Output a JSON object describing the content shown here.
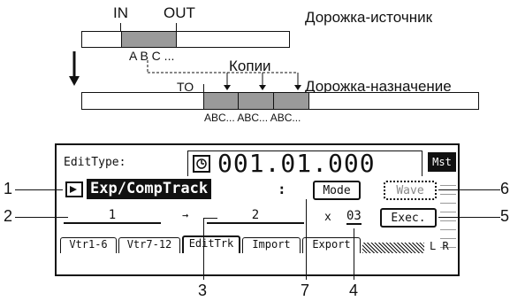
{
  "diagram": {
    "in_label": "IN",
    "out_label": "OUT",
    "source_track_label": "Дорожка-источник",
    "abc_label": "A B C ...",
    "copies_label": "Копии",
    "to_label": "TO",
    "dest_track_label": "Дорожка-назначение",
    "copies_abc": "ABC... ABC... ABC..."
  },
  "screen": {
    "edit_type_label": "EditType:",
    "time_value": "001.01.000",
    "mst_label": "Mst",
    "function_name": "Exp/CompTrack",
    "colon": ":",
    "mode_button": "Mode",
    "wave_button": "Wave",
    "exec_button": "Exec.",
    "source_track_value": "1",
    "arrow": "→",
    "dest_track_value": "2",
    "times_symbol": "x",
    "copy_count": "03",
    "lr_label": "L R",
    "tabs": [
      "Vtr1-6",
      "Vtr7-12",
      "EditTrk",
      "Import",
      "Export"
    ],
    "active_tab": "EditTrk"
  },
  "callouts": [
    "1",
    "2",
    "3",
    "4",
    "5",
    "6",
    "7"
  ]
}
